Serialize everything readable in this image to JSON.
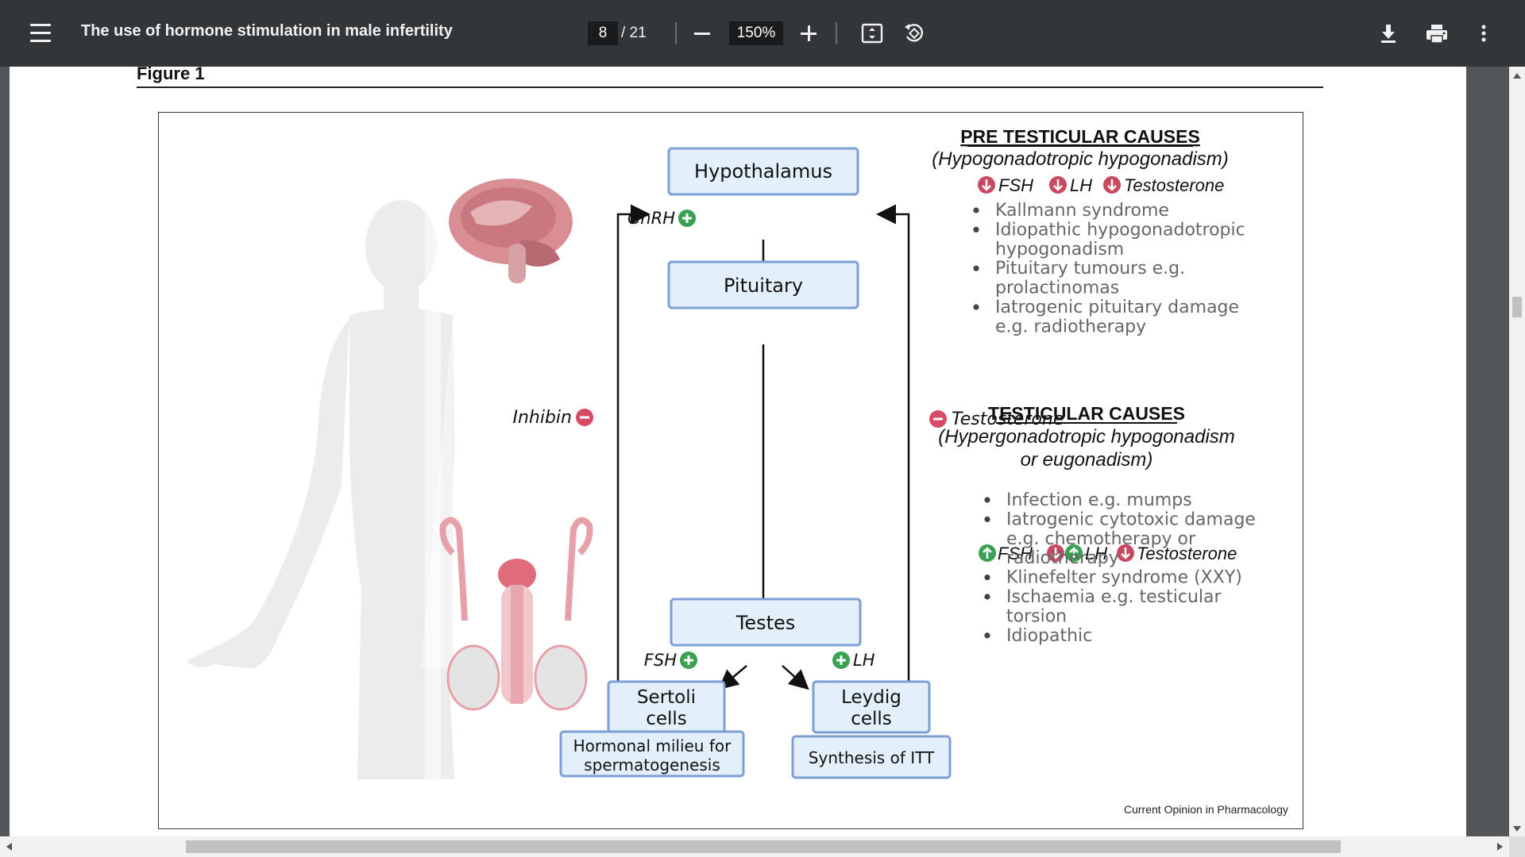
{
  "toolbar": {
    "title": "The use of hormone stimulation in male infertility",
    "page_current": "8",
    "page_total": "/ 21",
    "zoom": "150%",
    "icons": [
      "menu-icon",
      "zoom-out-icon",
      "zoom-in-icon",
      "fit-page-icon",
      "rotate-icon",
      "download-icon",
      "print-icon",
      "more-vert-icon"
    ]
  },
  "page": {
    "figure_label": "Figure 1",
    "credit": "Current Opinion in Pharmacology"
  },
  "diagram": {
    "nodes": {
      "hypothalamus": "Hypothalamus",
      "pituitary": "Pituitary",
      "testes": "Testes",
      "sertoli_1": "Sertoli",
      "sertoli_2": "cells",
      "leydig_1": "Leydig",
      "leydig_2": "cells",
      "milieu_1": "Hormonal milieu for",
      "milieu_2": "spermatogenesis",
      "itt": "Synthesis of ITT"
    },
    "edge_labels": {
      "gnrh": "GnRH",
      "inhibin": "Inhibin",
      "testosterone": "Testosterone",
      "fsh": "FSH",
      "lh": "LH"
    },
    "pre_testicular": {
      "title": "PRE TESTICULAR CAUSES",
      "subtitle": "(Hypogonadotropic hypogonadism)",
      "markers": [
        "FSH",
        "LH",
        "Testosterone"
      ],
      "items": [
        [
          "Kallmann syndrome"
        ],
        [
          "Idiopathic hypogonadotropic",
          "hypogonadism"
        ],
        [
          "Pituitary tumours e.g.",
          "prolactinomas"
        ],
        [
          "Iatrogenic pituitary damage",
          "e.g. radiotherapy"
        ]
      ]
    },
    "testicular": {
      "title": "TESTICULAR CAUSES",
      "subtitle_1": "(Hypergonadotropic hypogonadism",
      "subtitle_2": "or eugonadism)",
      "markers": [
        "FSH",
        "LH",
        "Testosterone"
      ],
      "items": [
        [
          "Infection e.g. mumps"
        ],
        [
          "Iatrogenic cytotoxic damage",
          "e.g. chemotherapy or",
          "radiotherapy"
        ],
        [
          "Klinefelter syndrome (XXY)"
        ],
        [
          "Ischaemia e.g. testicular",
          "torsion"
        ],
        [
          "Idiopathic"
        ]
      ]
    },
    "colors": {
      "box_fill": "#e3f0fb",
      "box_stroke": "#7d9fd4",
      "plus_green": "#3aa153",
      "minus_red": "#d64a64",
      "down_red": "#c94a60",
      "up_green": "#3aa153",
      "body_gray": "#e6e6e6"
    }
  }
}
